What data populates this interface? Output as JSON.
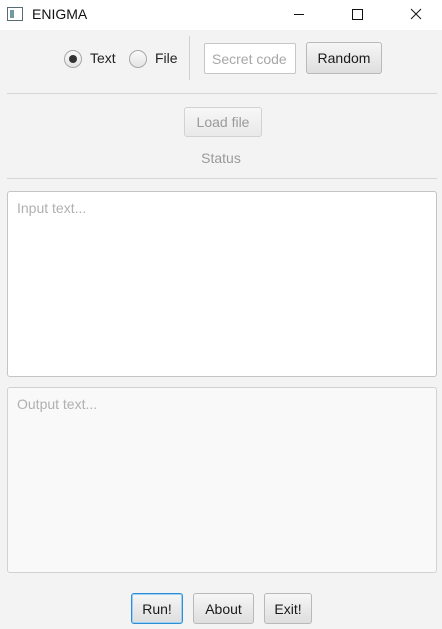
{
  "window": {
    "title": "ENIGMA",
    "icon": "app-window-icon",
    "controls": [
      "minimize-icon",
      "maximize-icon",
      "close-icon"
    ]
  },
  "mode": {
    "options": [
      {
        "label": "Text",
        "selected": true
      },
      {
        "label": "File",
        "selected": false
      }
    ]
  },
  "secret": {
    "placeholder": "Secret code",
    "value": ""
  },
  "buttons": {
    "random": "Random",
    "load_file": "Load file",
    "run": "Run!",
    "about": "About",
    "exit": "Exit!"
  },
  "status": {
    "text": "Status"
  },
  "input": {
    "placeholder": "Input text...",
    "value": ""
  },
  "output": {
    "placeholder": "Output text...",
    "value": ""
  },
  "colors": {
    "background": "#f3f3f3",
    "focus_accent": "#2b8ed6",
    "disabled_text": "#9a9a9a"
  }
}
